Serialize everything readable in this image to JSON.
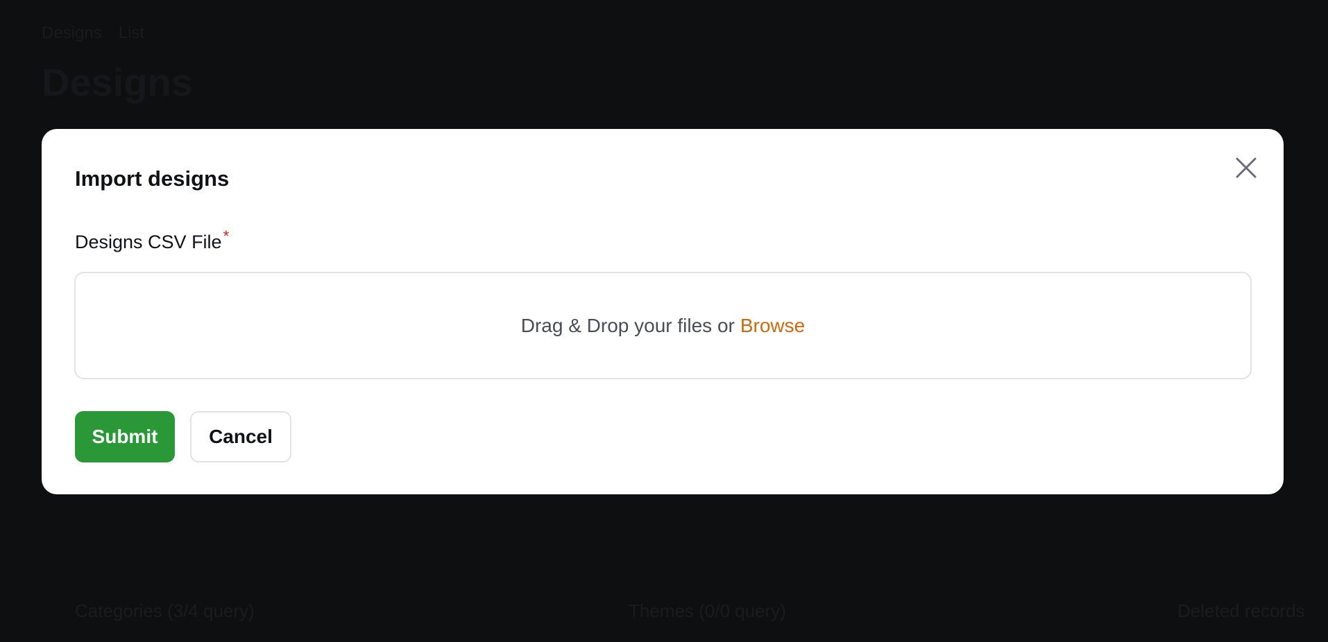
{
  "background": {
    "breadcrumb": [
      "Designs",
      "List"
    ],
    "page_title": "Designs",
    "stats": [
      "Categories (3/4 query)",
      "Themes (0/0 query)",
      "Deleted records"
    ]
  },
  "modal": {
    "title": "Import designs",
    "field_label": "Designs CSV File",
    "required_mark": "*",
    "dropzone_text": "Drag & Drop your files or",
    "browse_label": "Browse",
    "submit_label": "Submit",
    "cancel_label": "Cancel"
  },
  "colors": {
    "submit_bg": "#2a9837",
    "browse_link": "#cc6a10",
    "required": "#d11a1a",
    "overlay": "#0e0f11"
  },
  "icons": {
    "close": "close-icon"
  }
}
